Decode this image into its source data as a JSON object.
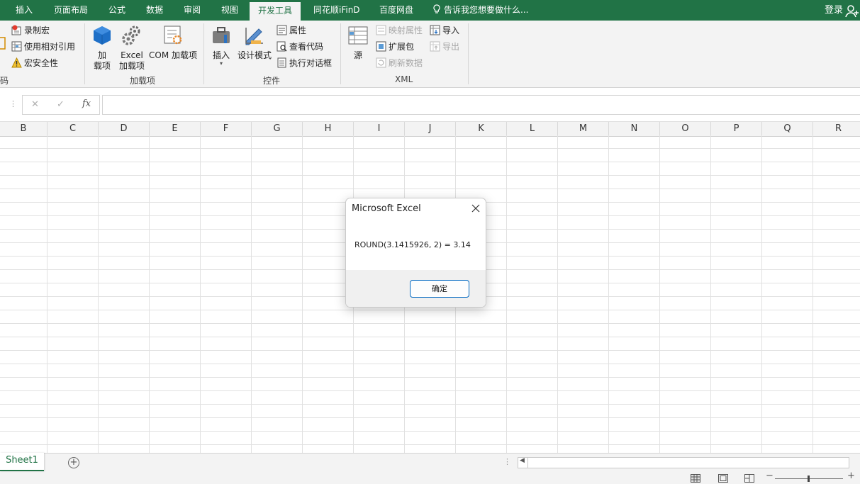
{
  "tabs": [
    {
      "label": "插入"
    },
    {
      "label": "页面布局"
    },
    {
      "label": "公式"
    },
    {
      "label": "数据"
    },
    {
      "label": "审阅"
    },
    {
      "label": "视图"
    },
    {
      "label": "开发工具",
      "active": true
    },
    {
      "label": "同花顺iFinD"
    },
    {
      "label": "百度网盘"
    }
  ],
  "tell_me": "告诉我您想要做什么...",
  "login": "登录",
  "ribbon": {
    "code": {
      "label": "代码",
      "record_macro": "录制宏",
      "relative_ref": "使用相对引用",
      "macro_security": "宏安全性"
    },
    "addins": {
      "label": "加载项",
      "addin_line1": "加",
      "addin_line2": "载项",
      "excel_line1": "Excel",
      "excel_line2": "加载项",
      "com": "COM 加载项"
    },
    "controls": {
      "label": "控件",
      "insert": "插入",
      "design_mode": "设计模式",
      "properties": "属性",
      "view_code": "查看代码",
      "run_dialog": "执行对话框"
    },
    "xml": {
      "label": "XML",
      "source": "源",
      "map_props": "映射属性",
      "expansion": "扩展包",
      "refresh": "刷新数据",
      "import": "导入",
      "export": "导出"
    }
  },
  "formula_bar": {
    "cancel": "✕",
    "enter": "✓",
    "fx": "fx",
    "value": ""
  },
  "columns": [
    "B",
    "C",
    "D",
    "E",
    "F",
    "G",
    "H",
    "I",
    "J",
    "K",
    "L",
    "M",
    "N",
    "O",
    "P",
    "Q",
    "R"
  ],
  "sheet": {
    "tab": "Sheet1",
    "add": "+"
  },
  "dialog": {
    "title": "Microsoft Excel",
    "message": "ROUND(3.1415926, 2) = 3.14",
    "ok": "确定"
  }
}
